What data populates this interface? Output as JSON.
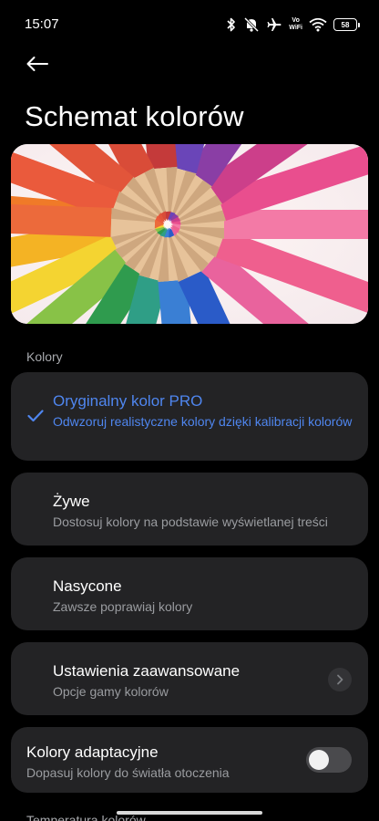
{
  "status": {
    "time": "15:07",
    "vowifi_top": "Vo",
    "vowifi_bottom": "WiFi",
    "battery": "58"
  },
  "header": {
    "title": "Schemat kolorów"
  },
  "section": {
    "colors_label": "Kolory",
    "next_label": "Temperatura kolorów"
  },
  "options": [
    {
      "title": "Oryginalny kolor PRO",
      "subtitle": "Odwzoruj realistyczne kolory dzięki kalibracji kolorów",
      "selected": true
    },
    {
      "title": "Żywe",
      "subtitle": "Dostosuj kolory na podstawie wyświetlanej treści",
      "selected": false
    },
    {
      "title": "Nasycone",
      "subtitle": "Zawsze poprawiaj kolory",
      "selected": false
    }
  ],
  "advanced": {
    "title": "Ustawienia zaawansowane",
    "subtitle": "Opcje gamy kolorów"
  },
  "adaptive": {
    "title": "Kolory adaptacyjne",
    "subtitle": "Dopasuj kolory do światła otoczenia",
    "enabled": false
  },
  "colors": {
    "accent": "#4f86ef",
    "card": "#232325",
    "background": "#000000"
  }
}
